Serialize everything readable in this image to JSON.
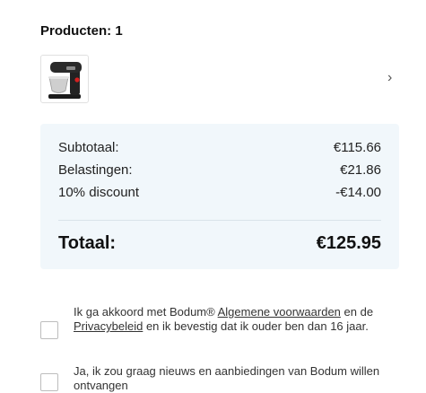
{
  "products": {
    "title": "Producten: 1",
    "item": {
      "image": "stand-mixer-thumbnail",
      "chevron": "›"
    }
  },
  "summary": {
    "subtotal_label": "Subtotaal:",
    "subtotal_value": "€115.66",
    "tax_label": "Belastingen:",
    "tax_value": "€21.86",
    "discount_label": "10% discount",
    "discount_value": "-€14.00",
    "total_label": "Totaal:",
    "total_value": "€125.95"
  },
  "consent": {
    "terms_text_1": "Ik ga akkoord met Bodum® ",
    "terms_link": "Algemene voorwaarden",
    "terms_text_2": " en de ",
    "privacy_link": "Privacybeleid",
    "terms_text_3": " en ik bevestig dat ik ouder ben dan 16 jaar.",
    "newsletter_text": "Ja, ik zou graag nieuws en aanbiedingen van Bodum willen ontvangen"
  },
  "colors": {
    "summary_background": "#f1f7fb"
  }
}
